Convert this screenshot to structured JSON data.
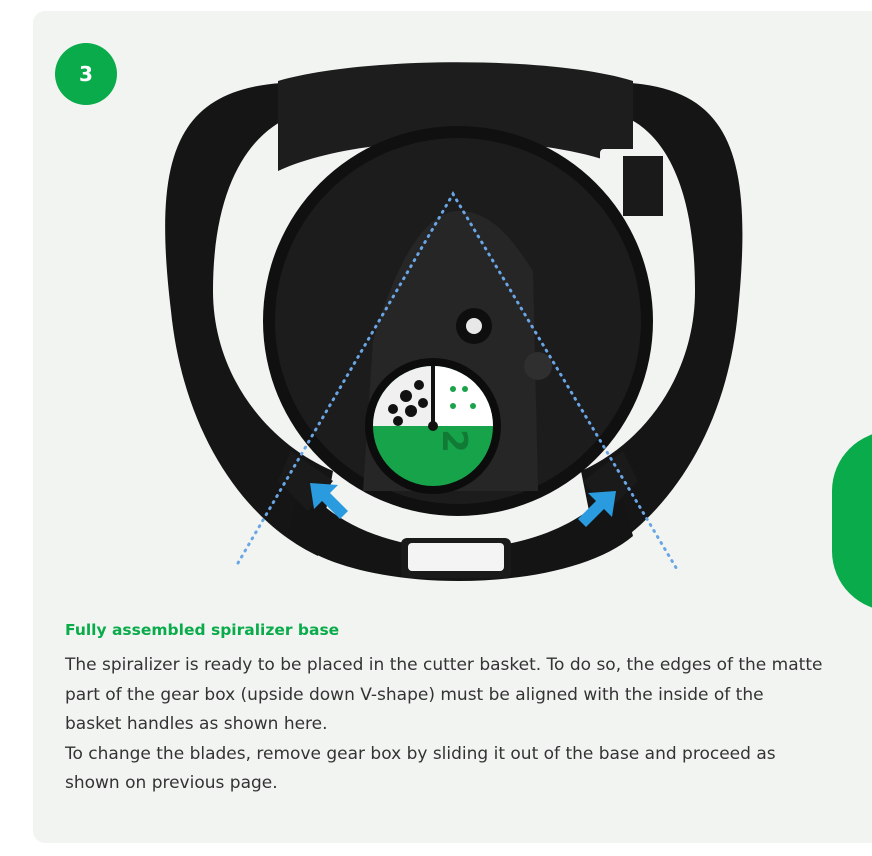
{
  "step": {
    "number": "3"
  },
  "caption": {
    "title": "Fully assembled spiralizer base",
    "paragraphs": [
      "The spiralizer is ready to be placed in the cutter basket. To do so, the edges of the matte part of the gear box (upside down V-shape) must be aligned with the inside of the basket handles as shown here.",
      "To change the blades, remove gear box by sliding it out of the base and proceed as shown on previous page."
    ]
  },
  "illustration": {
    "dial_number": "2",
    "icons": [
      "spiralizer-base-image",
      "alignment-arrow-left-icon",
      "alignment-arrow-right-icon"
    ]
  },
  "colors": {
    "accent_green": "#0aab4a",
    "arrow_blue": "#2b9be0",
    "guide_dots": "#6aa6e6",
    "card_background": "#f2f4f2",
    "body_text": "#333333"
  }
}
